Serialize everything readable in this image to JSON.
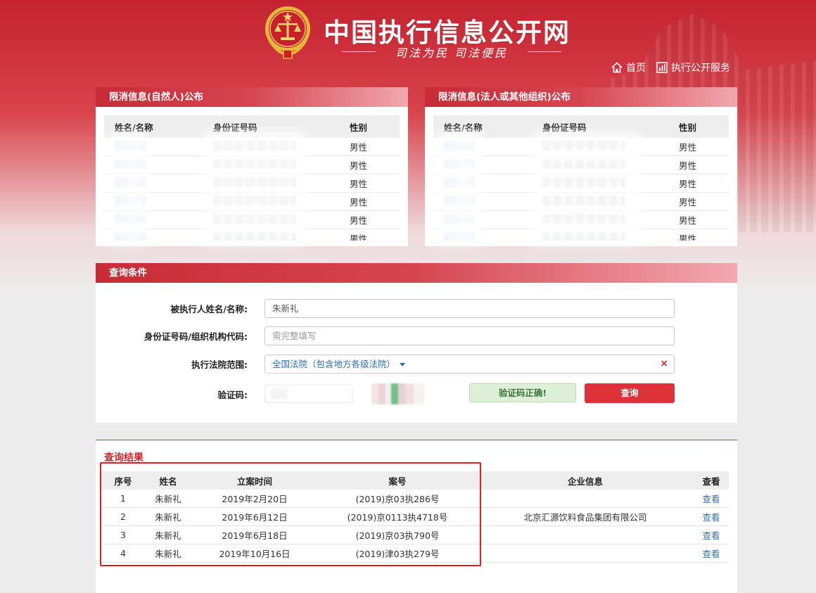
{
  "header": {
    "site_title": "中国执行信息公开网",
    "slogan": "司法为民  司法便民",
    "nav": [
      {
        "label": "首页",
        "icon": "home-icon"
      },
      {
        "label": "执行公开服务",
        "icon": "bar-chart-icon"
      }
    ]
  },
  "publication_natural": {
    "title": "限消信息(自然人)公布",
    "columns": [
      "姓名/名称",
      "身份证号码",
      "性别"
    ],
    "rows": [
      {
        "gender": "男性"
      },
      {
        "gender": "男性"
      },
      {
        "gender": "男性"
      },
      {
        "gender": "男性"
      },
      {
        "gender": "男性"
      },
      {
        "gender": "男性"
      }
    ]
  },
  "publication_legal": {
    "title": "限消信息(法人或其他组织)公布",
    "columns": [
      "姓名/名称",
      "身份证号码",
      "性别"
    ],
    "rows": [
      {
        "gender": "男性"
      },
      {
        "gender": "男性"
      },
      {
        "gender": "男性"
      },
      {
        "gender": "男性"
      },
      {
        "gender": "男性"
      },
      {
        "gender": "男性"
      }
    ]
  },
  "query": {
    "title": "查询条件",
    "name_label": "被执行人姓名/名称:",
    "name_value": "朱新礼",
    "id_label": "身份证号码/组织机构代码:",
    "id_placeholder": "需完整填写",
    "court_label": "执行法院范围:",
    "court_value": "全国法院（包含地方各级法院）",
    "court_clear": "×",
    "captcha_label": "验证码:",
    "captcha_status": "验证码正确!",
    "submit_label": "查询"
  },
  "results": {
    "title": "查询结果",
    "columns": [
      "序号",
      "姓名",
      "立案时间",
      "案号",
      "企业信息",
      "查看"
    ],
    "rows": [
      {
        "index": "1",
        "name": "朱新礼",
        "date": "2019年2月20日",
        "case_no": "(2019)京03执286号",
        "company": "",
        "view": "查看"
      },
      {
        "index": "2",
        "name": "朱新礼",
        "date": "2019年6月12日",
        "case_no": "(2019)京0113执4718号",
        "company": "北京汇源饮料食品集团有限公司",
        "view": "查看"
      },
      {
        "index": "3",
        "name": "朱新礼",
        "date": "2019年6月18日",
        "case_no": "(2019)京03执790号",
        "company": "",
        "view": "查看"
      },
      {
        "index": "4",
        "name": "朱新礼",
        "date": "2019年10月16日",
        "case_no": "(2019)津03执279号",
        "company": "",
        "view": "查看"
      }
    ]
  },
  "colors": {
    "brand_red": "#c4232f",
    "accent_blue": "#2c6fb7",
    "highlight_red": "#e02020",
    "success_green": "#3c763d"
  }
}
